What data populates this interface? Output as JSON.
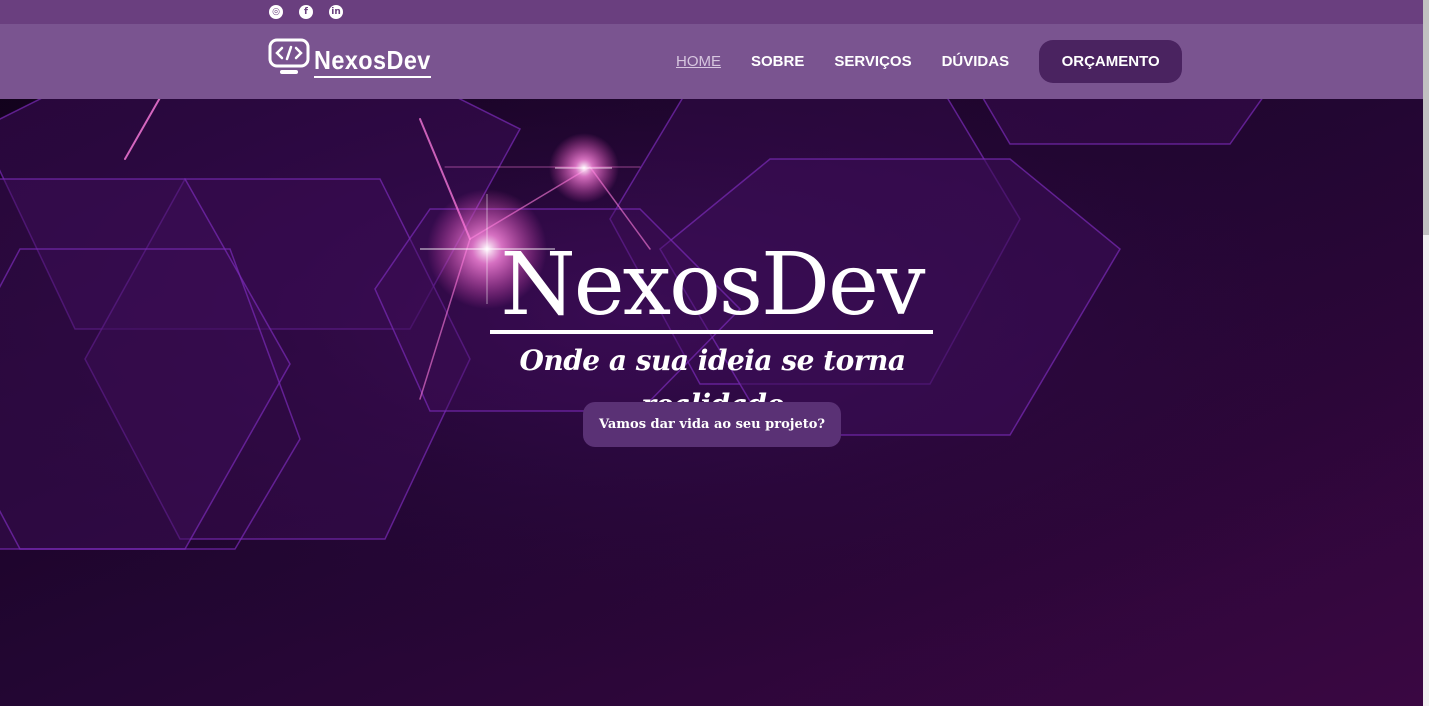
{
  "social": {
    "icons": [
      "instagram-icon",
      "facebook-icon",
      "linkedin-icon"
    ]
  },
  "brand": {
    "name": "NexosDev",
    "icon": "code-monitor-icon"
  },
  "nav": {
    "items": [
      {
        "label": "HOME",
        "active": true
      },
      {
        "label": "SOBRE",
        "active": false
      },
      {
        "label": "SERVIÇOS",
        "active": false
      },
      {
        "label": "DÚVIDAS",
        "active": false
      }
    ],
    "cta_label": "ORÇAMENTO"
  },
  "hero": {
    "title": "NexosDev",
    "subtitle": "Onde a sua ideia se torna realidade",
    "button_label": "Vamos dar vida ao seu projeto?"
  },
  "colors": {
    "topbar": "#6a3f7f",
    "navbar": "#7a5490",
    "cta": "#4a2360",
    "hero_button": "#5a3175",
    "hero_bg": "#1a0524",
    "accent_glow": "#ff6ad5"
  }
}
